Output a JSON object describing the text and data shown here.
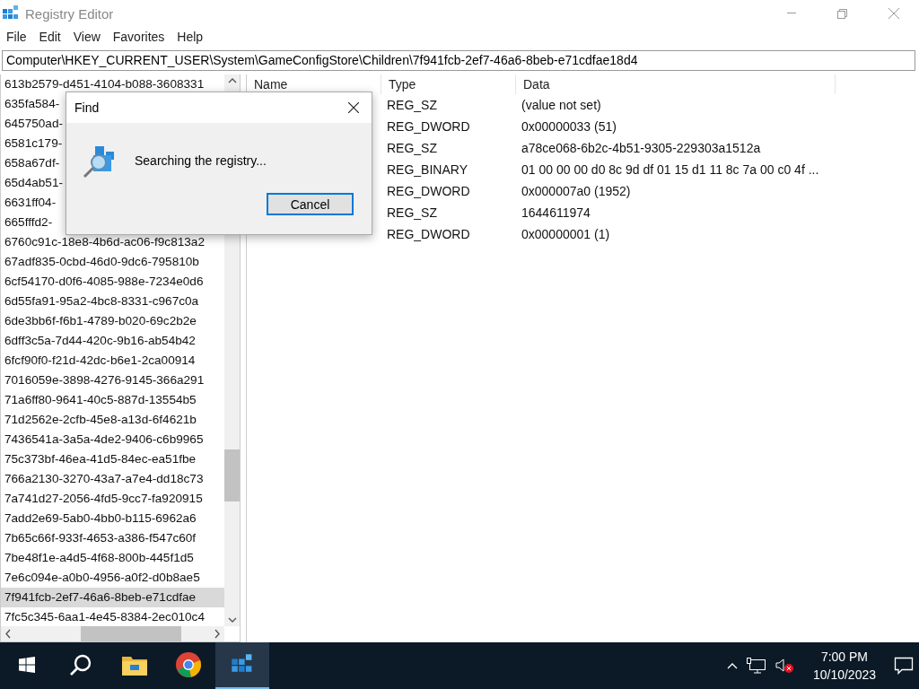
{
  "window": {
    "title": "Registry Editor"
  },
  "menu": [
    "File",
    "Edit",
    "View",
    "Favorites",
    "Help"
  ],
  "address": "Computer\\HKEY_CURRENT_USER\\System\\GameConfigStore\\Children\\7f941fcb-2ef7-46a6-8beb-e71cdfae18d4",
  "tree": {
    "items": [
      {
        "label": "613b2579-d451-4104-b088-3608331",
        "selected": false
      },
      {
        "label": "635fa584-",
        "selected": false
      },
      {
        "label": "645750ad-",
        "selected": false
      },
      {
        "label": "6581c179-",
        "selected": false
      },
      {
        "label": "658a67df-",
        "selected": false
      },
      {
        "label": "65d4ab51-",
        "selected": false
      },
      {
        "label": "6631ff04-",
        "selected": false
      },
      {
        "label": "665fffd2-",
        "selected": false
      },
      {
        "label": "6760c91c-18e8-4b6d-ac06-f9c813a2",
        "selected": false
      },
      {
        "label": "67adf835-0cbd-46d0-9dc6-795810b",
        "selected": false
      },
      {
        "label": "6cf54170-d0f6-4085-988e-7234e0d6",
        "selected": false
      },
      {
        "label": "6d55fa91-95a2-4bc8-8331-c967c0a",
        "selected": false
      },
      {
        "label": "6de3bb6f-f6b1-4789-b020-69c2b2e",
        "selected": false
      },
      {
        "label": "6dff3c5a-7d44-420c-9b16-ab54b42",
        "selected": false
      },
      {
        "label": "6fcf90f0-f21d-42dc-b6e1-2ca00914",
        "selected": false
      },
      {
        "label": "7016059e-3898-4276-9145-366a291",
        "selected": false
      },
      {
        "label": "71a6ff80-9641-40c5-887d-13554b5",
        "selected": false
      },
      {
        "label": "71d2562e-2cfb-45e8-a13d-6f4621b",
        "selected": false
      },
      {
        "label": "7436541a-3a5a-4de2-9406-c6b9965",
        "selected": false
      },
      {
        "label": "75c373bf-46ea-41d5-84ec-ea51fbe",
        "selected": false
      },
      {
        "label": "766a2130-3270-43a7-a7e4-dd18c73",
        "selected": false
      },
      {
        "label": "7a741d27-2056-4fd5-9cc7-fa920915",
        "selected": false
      },
      {
        "label": "7add2e69-5ab0-4bb0-b115-6962a6",
        "selected": false
      },
      {
        "label": "7b65c66f-933f-4653-a386-f547c60f",
        "selected": false
      },
      {
        "label": "7be48f1e-a4d5-4f68-800b-445f1d5",
        "selected": false
      },
      {
        "label": "7e6c094e-a0b0-4956-a0f2-d0b8ae5",
        "selected": false
      },
      {
        "label": "7f941fcb-2ef7-46a6-8beb-e71cdfae",
        "selected": true
      },
      {
        "label": "7fc5c345-6aa1-4e45-8384-2ec010c4",
        "selected": false
      }
    ]
  },
  "values": {
    "columns": [
      "Name",
      "Type",
      "Data"
    ],
    "rows": [
      {
        "type": "REG_SZ",
        "data": "(value not set)"
      },
      {
        "type": "REG_DWORD",
        "data": "0x00000033 (51)"
      },
      {
        "type": "REG_SZ",
        "data": "a78ce068-6b2c-4b51-9305-229303a1512a"
      },
      {
        "type": "REG_BINARY",
        "data": "01 00 00 00 d0 8c 9d df 01 15 d1 11 8c 7a 00 c0 4f ..."
      },
      {
        "type": "REG_DWORD",
        "data": "0x000007a0 (1952)"
      },
      {
        "type": "REG_SZ",
        "data": "1644611974"
      },
      {
        "type": "REG_DWORD",
        "data": "0x00000001 (1)"
      }
    ]
  },
  "dialog": {
    "title": "Find",
    "message": "Searching the registry...",
    "button": "Cancel"
  },
  "taskbar": {
    "apps": [
      {
        "kind": "start",
        "selected": false
      },
      {
        "kind": "search",
        "selected": false
      },
      {
        "kind": "folder",
        "selected": false
      },
      {
        "kind": "browser",
        "selected": false
      },
      {
        "kind": "registry",
        "selected": true
      }
    ],
    "time": "7:00 PM",
    "date": "10/10/2023"
  }
}
